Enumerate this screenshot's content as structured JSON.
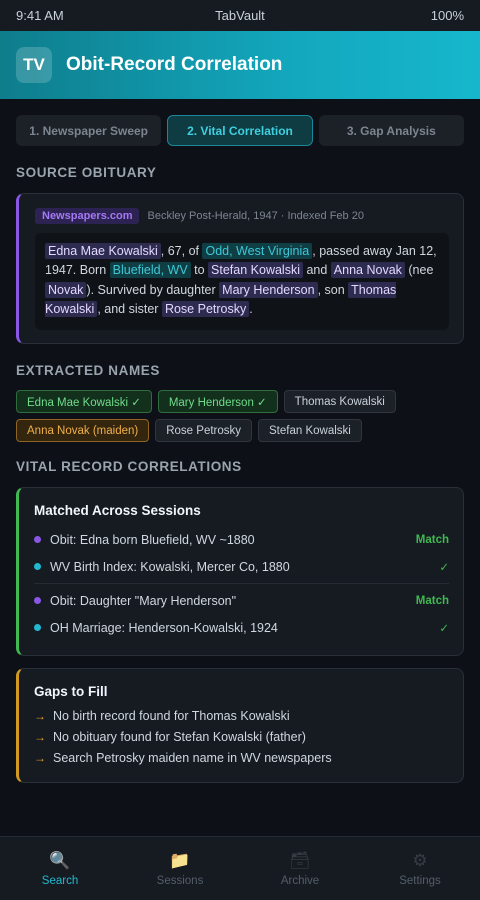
{
  "status_bar": {
    "time": "9:41 AM",
    "app": "TabVault",
    "battery": "100%"
  },
  "header": {
    "logo": "TV",
    "title": "Obit-Record Correlation"
  },
  "tabs": [
    {
      "label": "1. Newspaper Sweep",
      "active": false
    },
    {
      "label": "2. Vital Correlation",
      "active": true
    },
    {
      "label": "3. Gap Analysis",
      "active": false
    }
  ],
  "source_obituary": {
    "heading": "SOURCE OBITUARY",
    "source": "Newspapers.com",
    "meta": "Beckley Post-Herald, 1947 · Indexed Feb 20",
    "text": {
      "name_1": "Edna Mae Kowalski",
      "t1": ", 67, of ",
      "place_1": "Odd, West Virginia",
      "t2": ", passed away Jan 12, 1947. Born ",
      "place_2": "Bluefield, WV",
      "t3": " to ",
      "name_2": "Stefan Kowalski",
      "t4": " and ",
      "name_3": "Anna Novak",
      "t5": " (nee ",
      "name_4": "Novak",
      "t6": "). Survived by daughter ",
      "name_5": "Mary Henderson",
      "t7": ", son ",
      "name_6": "Thomas Kowalski",
      "t8": ", and sister ",
      "name_7": "Rose Petrosky",
      "t9": "."
    }
  },
  "extracted_names": {
    "heading": "EXTRACTED NAMES",
    "chips": [
      {
        "label": "Edna Mae Kowalski ✓",
        "state": "matched"
      },
      {
        "label": "Mary Henderson ✓",
        "state": "matched"
      },
      {
        "label": "Thomas Kowalski",
        "state": "neutral"
      },
      {
        "label": "Anna Novak (maiden)",
        "state": "maiden"
      },
      {
        "label": "Rose Petrosky",
        "state": "neutral"
      },
      {
        "label": "Stefan Kowalski",
        "state": "neutral"
      }
    ]
  },
  "correlations": {
    "heading": "VITAL RECORD CORRELATIONS",
    "matched": {
      "title": "Matched Across Sessions",
      "groups": [
        {
          "obit": "Obit: Edna born Bluefield, WV ~1880",
          "obit_status": "Match",
          "record": "WV Birth Index: Kowalski, Mercer Co, 1880",
          "record_status": "✓"
        },
        {
          "obit": "Obit: Daughter \"Mary Henderson\"",
          "obit_status": "Match",
          "record": "OH Marriage: Henderson-Kowalski, 1924",
          "record_status": "✓"
        }
      ]
    },
    "gaps": {
      "title": "Gaps to Fill",
      "arrow": "→",
      "items": [
        "No birth record found for Thomas Kowalski",
        "No obituary found for Stefan Kowalski (father)",
        "Search Petrosky maiden name in WV newspapers"
      ]
    }
  },
  "bottom_nav": [
    {
      "label": "Search",
      "icon": "🔍",
      "icon_name": "search-icon",
      "active": true
    },
    {
      "label": "Sessions",
      "icon": "📁",
      "icon_name": "folder-icon",
      "active": false
    },
    {
      "label": "Archive",
      "icon": "🗃",
      "icon_name": "archive-icon",
      "active": false
    },
    {
      "label": "Settings",
      "icon": "⚙",
      "icon_name": "gear-icon",
      "active": false
    }
  ],
  "colors": {
    "accent": "#22b8cf",
    "purple": "#8957e5",
    "success": "#3fb950",
    "warning": "#d29922"
  }
}
